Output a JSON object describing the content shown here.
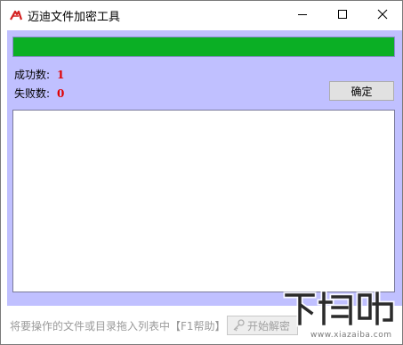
{
  "window": {
    "title": "迈迪文件加密工具"
  },
  "progress": {
    "value": 1.0,
    "color": "#0baf25"
  },
  "stats": {
    "success_label": "成功数:",
    "success_value": "1",
    "fail_label": "失败数:",
    "fail_value": "0"
  },
  "buttons": {
    "ok_label": "确定",
    "start_label": "开始解密"
  },
  "statusbar": {
    "hint": "将要操作的文件或目录拖入列表中【F1帮助】"
  },
  "watermark": {
    "logo_text": "下载吧",
    "url": "www.xiazaiba.com"
  },
  "colors": {
    "client_bg": "#c0c0ff",
    "accent_red": "#e00000"
  }
}
